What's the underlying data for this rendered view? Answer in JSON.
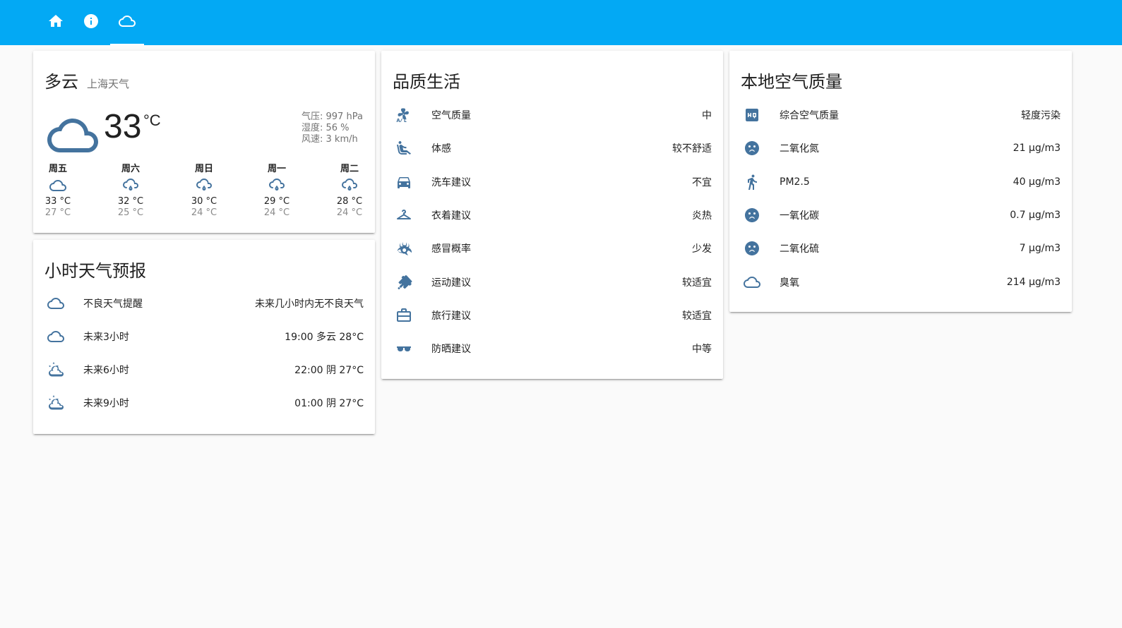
{
  "nav": {
    "tabs": [
      {
        "icon": "home-icon"
      },
      {
        "icon": "info-icon"
      },
      {
        "icon": "cloud-icon",
        "active": true
      }
    ]
  },
  "weather": {
    "condition": "多云",
    "location": "上海天气",
    "temp": "33",
    "unit": "°C",
    "icon": "cloud-icon",
    "pressure": "气压: 997 hPa",
    "humidity": "湿度: 56 %",
    "wind": "风速: 3 km/h",
    "forecast": [
      {
        "day": "周五",
        "icon": "cloud-icon",
        "high": "33 °C",
        "low": "27 °C"
      },
      {
        "day": "周六",
        "icon": "rain-cloud-icon",
        "high": "32 °C",
        "low": "25 °C"
      },
      {
        "day": "周日",
        "icon": "rain-cloud-icon",
        "high": "30 °C",
        "low": "24 °C"
      },
      {
        "day": "周一",
        "icon": "rain-cloud-icon",
        "high": "29 °C",
        "low": "24 °C"
      },
      {
        "day": "周二",
        "icon": "rain-cloud-icon",
        "high": "28 °C",
        "low": "24 °C"
      }
    ]
  },
  "hourly": {
    "title": "小时天气预报",
    "rows": [
      {
        "icon": "cloud-icon",
        "label": "不良天气提醒",
        "value": "未来几小时内无不良天气"
      },
      {
        "icon": "cloud-icon",
        "label": "未来3小时",
        "value": "19:00 多云 28°C"
      },
      {
        "icon": "partly-cloudy-icon",
        "label": "未来6小时",
        "value": "22:00 阴 27°C"
      },
      {
        "icon": "partly-cloudy-icon",
        "label": "未来9小时",
        "value": "01:00 阴 27°C"
      }
    ]
  },
  "quality_life": {
    "title": "品质生活",
    "rows": [
      {
        "icon": "air-conditioner-icon",
        "label": "空气质量",
        "value": "中"
      },
      {
        "icon": "seat-recline-icon",
        "label": "体感",
        "value": "较不舒适"
      },
      {
        "icon": "car-icon",
        "label": "洗车建议",
        "value": "不宜"
      },
      {
        "icon": "hanger-icon",
        "label": "衣着建议",
        "value": "炎热"
      },
      {
        "icon": "biohazard-icon",
        "label": "感冒概率",
        "value": "少发"
      },
      {
        "icon": "badminton-icon",
        "label": "运动建议",
        "value": "较适宜"
      },
      {
        "icon": "briefcase-icon",
        "label": "旅行建议",
        "value": "较适宜"
      },
      {
        "icon": "sunglasses-icon",
        "label": "防晒建议",
        "value": "中等"
      }
    ]
  },
  "air": {
    "title": "本地空气质量",
    "rows": [
      {
        "icon": "hq-icon",
        "label": "综合空气质量",
        "value": "轻度污染"
      },
      {
        "icon": "sad-face-icon",
        "label": "二氧化氮",
        "value": "21 μg/m3"
      },
      {
        "icon": "walk-icon",
        "label": "PM2.5",
        "value": "40 μg/m3"
      },
      {
        "icon": "sad-face-icon",
        "label": "一氧化碳",
        "value": "0.7 μg/m3"
      },
      {
        "icon": "sad-face-icon",
        "label": "二氧化硫",
        "value": "7 μg/m3"
      },
      {
        "icon": "cloud-icon",
        "label": "臭氧",
        "value": "214 μg/m3"
      }
    ]
  },
  "colors": {
    "header": "#03a9f4",
    "icon": "#44739e",
    "background": "#fafafa"
  }
}
